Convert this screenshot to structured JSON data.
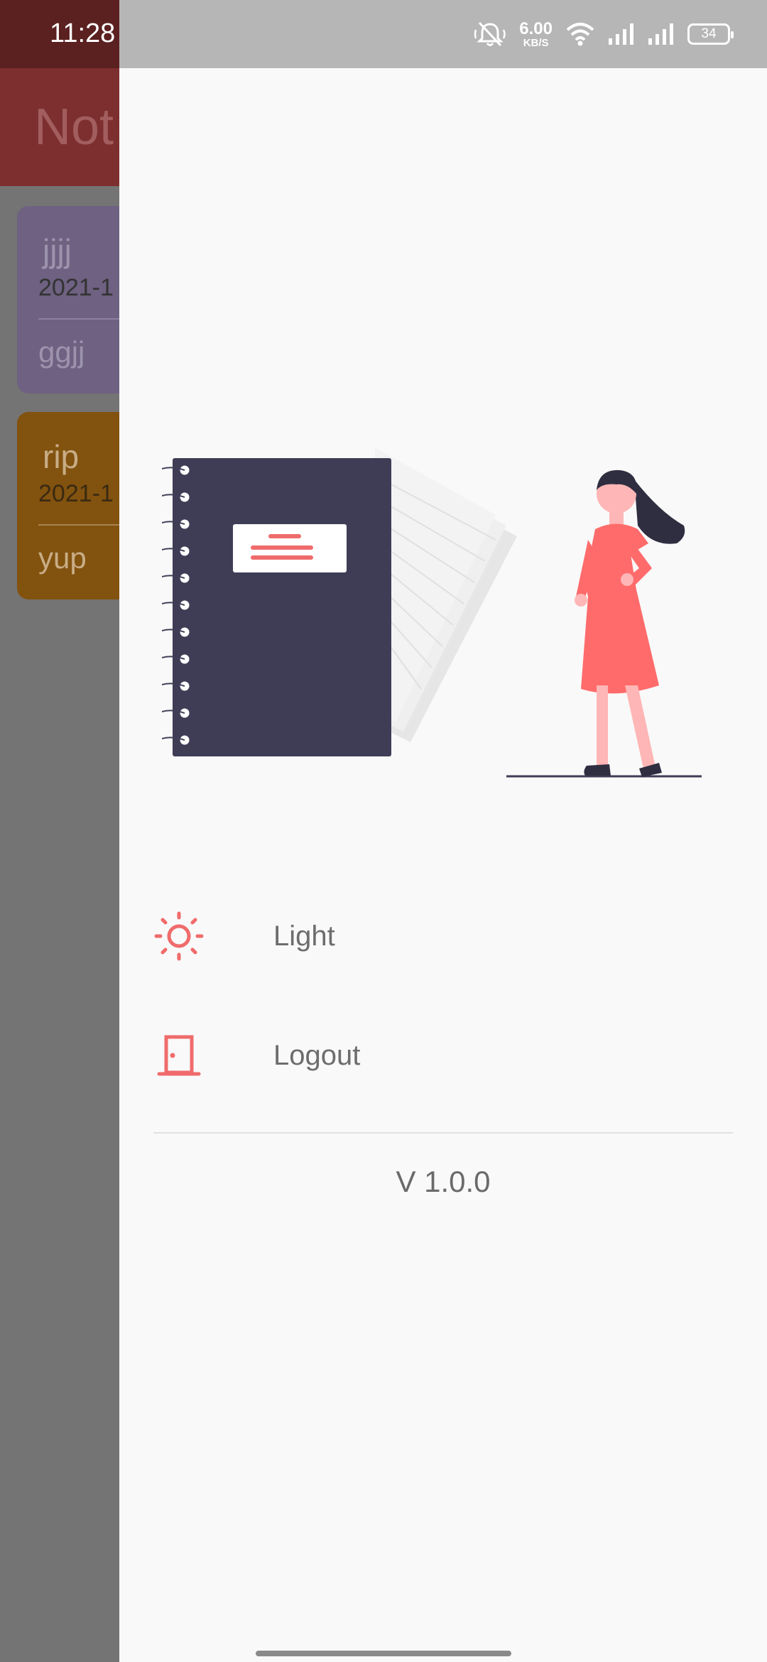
{
  "status_bar": {
    "time": "11:28",
    "net_speed_value": "6.00",
    "net_speed_unit": "KB/S",
    "battery_level": "34",
    "icons": [
      "bell-off-icon",
      "wifi-icon",
      "signal-icon",
      "signal-icon",
      "battery-icon"
    ]
  },
  "background": {
    "app_title": "Not",
    "notes": [
      {
        "title": "jjjj",
        "date": "2021-1",
        "body": "ggjj",
        "color": "#6e6181"
      },
      {
        "title": "rip",
        "date": "2021-1",
        "body": "yup",
        "color": "#82520f"
      }
    ]
  },
  "drawer": {
    "menu": [
      {
        "label": "Light",
        "icon": "sun-icon"
      },
      {
        "label": "Logout",
        "icon": "door-icon"
      }
    ],
    "version": "V 1.0.0",
    "accent_color": "#f06b6b"
  }
}
